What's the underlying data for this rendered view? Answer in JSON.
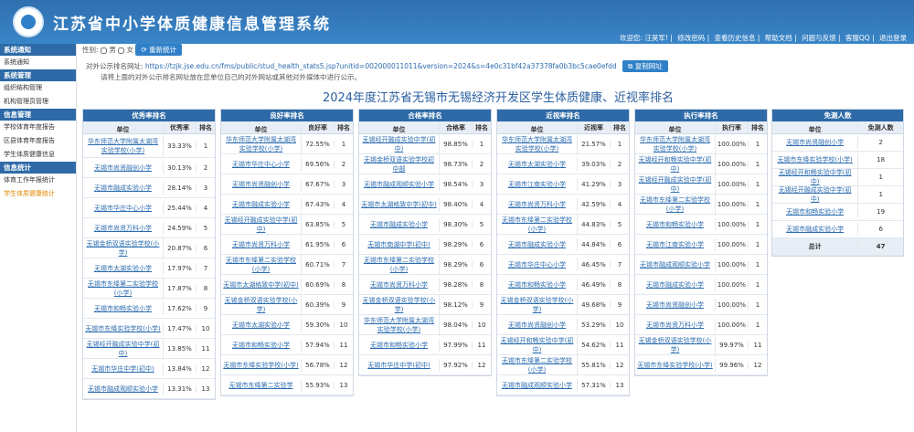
{
  "app": {
    "title": "江苏省中小学体质健康信息管理系统",
    "topbar": [
      "欢迎您: 汪昊军!",
      "修改密码",
      "查看历史信息",
      "帮助文档",
      "问题与反馈",
      "客服QQ",
      "退出登录"
    ]
  },
  "sidebar": [
    {
      "head": "系统通知",
      "items": [
        "系统通知"
      ]
    },
    {
      "head": "系统管理",
      "items": [
        "组织结构管理",
        "机构管理员管理"
      ]
    },
    {
      "head": "信息管理",
      "items": [
        "学校体育年度报告",
        "区县体育年度报告",
        "学生体质健康信息"
      ]
    },
    {
      "head": "信息统计",
      "items": [
        "体育工作年报统计",
        "学生体质健康统计"
      ]
    }
  ],
  "filters": {
    "gender_label": "性别:",
    "male": "男",
    "female": "女",
    "recount": "重新统计"
  },
  "share": {
    "label": "对外公示排名网址:",
    "url": "https://tzjk.jse.edu.cn/fms/public/stud_health_stats5.jsp?unitid=002000011011&version=2024&s=4e0c31bf42a37378fa0b3bc5cae0efdd",
    "copy_button": "复制网址",
    "note": "请将上面的对外公示排名网址放在您单位自己的对外网站或其他对外媒体中进行公示。"
  },
  "page_title": "2024年度江苏省无锡市无锡经济开发区学生体质健康、近视率排名",
  "tables": [
    {
      "title": "优秀率排名",
      "col_unit": "单位",
      "col_rate": "优秀率",
      "col_rank": "排名",
      "rows": [
        {
          "unit": "华东师范大学附属太湖湾实验学校(小学)",
          "rate": "33.33%",
          "rank": "1"
        },
        {
          "unit": "无锡市尚贤融创小学",
          "rate": "30.13%",
          "rank": "2"
        },
        {
          "unit": "无锡市融成实验小学",
          "rate": "28.14%",
          "rank": "3"
        },
        {
          "unit": "无锡市华庄中心小学",
          "rate": "25.44%",
          "rank": "4"
        },
        {
          "unit": "无锡市尚贤万科小学",
          "rate": "24.59%",
          "rank": "5"
        },
        {
          "unit": "无锡金桥双语实验学校(小学)",
          "rate": "20.87%",
          "rank": "6"
        },
        {
          "unit": "无锡市太湖实验小学",
          "rate": "17.97%",
          "rank": "7"
        },
        {
          "unit": "无锡市东绛第二实验学校(小学)",
          "rate": "17.87%",
          "rank": "8"
        },
        {
          "unit": "无锡市和畅实验小学",
          "rate": "17.62%",
          "rank": "9"
        },
        {
          "unit": "无锡市东绛实验学校(小学)",
          "rate": "17.47%",
          "rank": "10"
        },
        {
          "unit": "无锡经开融成实验中学(初中)",
          "rate": "13.85%",
          "rank": "11"
        },
        {
          "unit": "无锡市华庄中学(初中)",
          "rate": "13.84%",
          "rank": "12"
        },
        {
          "unit": "无锡市融成观顺实验小学",
          "rate": "13.31%",
          "rank": "13"
        }
      ]
    },
    {
      "title": "良好率排名",
      "col_unit": "单位",
      "col_rate": "良好率",
      "col_rank": "排名",
      "rows": [
        {
          "unit": "华东师范大学附属太湖湾实验学校(小学)",
          "rate": "72.55%",
          "rank": "1"
        },
        {
          "unit": "无锡市华庄中心小学",
          "rate": "69.56%",
          "rank": "2"
        },
        {
          "unit": "无锡市尚贤融创小学",
          "rate": "67.67%",
          "rank": "3"
        },
        {
          "unit": "无锡市融成实验小学",
          "rate": "67.43%",
          "rank": "4"
        },
        {
          "unit": "无锡经开融成实验中学(初中)",
          "rate": "63.85%",
          "rank": "5"
        },
        {
          "unit": "无锡市尚贤万科小学",
          "rate": "61.95%",
          "rank": "6"
        },
        {
          "unit": "无锡市东绛第二实验学校(小学)",
          "rate": "60.71%",
          "rank": "7"
        },
        {
          "unit": "无锡市太湖格致中学(初中)",
          "rate": "60.69%",
          "rank": "8"
        },
        {
          "unit": "无锡金桥双语实验学校(小学)",
          "rate": "60.39%",
          "rank": "9"
        },
        {
          "unit": "无锡市太湖实验小学",
          "rate": "59.30%",
          "rank": "10"
        },
        {
          "unit": "无锡市和畅实验小学",
          "rate": "57.94%",
          "rank": "11"
        },
        {
          "unit": "无锡市东绛实验学校(小学)",
          "rate": "56.78%",
          "rank": "12"
        },
        {
          "unit": "无锡市东绛第二实验学",
          "rate": "55.93%",
          "rank": "13"
        }
      ]
    },
    {
      "title": "合格率排名",
      "col_unit": "单位",
      "col_rate": "合格率",
      "col_rank": "排名",
      "rows": [
        {
          "unit": "无锡经开融成实验中学(初中)",
          "rate": "98.85%",
          "rank": "1"
        },
        {
          "unit": "无锡金桥双语实验学校初中部",
          "rate": "98.73%",
          "rank": "2"
        },
        {
          "unit": "无锡市融成观顺实验小学",
          "rate": "98.54%",
          "rank": "3"
        },
        {
          "unit": "无锡市太湖格致中学(初中)",
          "rate": "98.40%",
          "rank": "4"
        },
        {
          "unit": "无锡市融成实验小学",
          "rate": "98.30%",
          "rank": "5"
        },
        {
          "unit": "无锡市南湖中学(初中)",
          "rate": "98.29%",
          "rank": "6"
        },
        {
          "unit": "无锡市东绛第二实验学校(小学)",
          "rate": "98.29%",
          "rank": "6"
        },
        {
          "unit": "无锡市尚贤万科小学",
          "rate": "98.28%",
          "rank": "8"
        },
        {
          "unit": "无锡金桥双语实验学校(小学)",
          "rate": "98.12%",
          "rank": "9"
        },
        {
          "unit": "华东师范大学附属太湖湾实验学校(小学)",
          "rate": "98.04%",
          "rank": "10"
        },
        {
          "unit": "无锡市和畅实验小学",
          "rate": "97.99%",
          "rank": "11"
        },
        {
          "unit": "无锡市华庄中学(初中)",
          "rate": "97.92%",
          "rank": "12"
        }
      ]
    },
    {
      "title": "近视率排名",
      "col_unit": "单位",
      "col_rate": "近视率",
      "col_rank": "排名",
      "rows": [
        {
          "unit": "华东师范大学附属太湖湾实验学校(小学)",
          "rate": "21.57%",
          "rank": "1"
        },
        {
          "unit": "无锡市太湖实验小学",
          "rate": "39.03%",
          "rank": "2"
        },
        {
          "unit": "无锡市江南实验小学",
          "rate": "41.29%",
          "rank": "3"
        },
        {
          "unit": "无锡市尚贤万科小学",
          "rate": "42.59%",
          "rank": "4"
        },
        {
          "unit": "无锡市东绛第二实验学校(小学)",
          "rate": "44.83%",
          "rank": "5"
        },
        {
          "unit": "无锡市融成实验小学",
          "rate": "44.84%",
          "rank": "6"
        },
        {
          "unit": "无锡市华庄中心小学",
          "rate": "46.45%",
          "rank": "7"
        },
        {
          "unit": "无锡市和畅实验小学",
          "rate": "46.49%",
          "rank": "8"
        },
        {
          "unit": "无锡金桥双语实验学校(小学)",
          "rate": "49.68%",
          "rank": "9"
        },
        {
          "unit": "无锡市尚贤融创小学",
          "rate": "53.29%",
          "rank": "10"
        },
        {
          "unit": "无锡经开和畅实验中学(初中)",
          "rate": "54.62%",
          "rank": "11"
        },
        {
          "unit": "无锡市东绛第二实验学校(小学)",
          "rate": "55.81%",
          "rank": "12"
        },
        {
          "unit": "无锡市融成观顺实验小学",
          "rate": "57.31%",
          "rank": "13"
        }
      ]
    },
    {
      "title": "执行率排名",
      "col_unit": "单位",
      "col_rate": "执行率",
      "col_rank": "排名",
      "rows": [
        {
          "unit": "华东师范大学附属太湖湾实验学校(小学)",
          "rate": "100.00%",
          "rank": "1"
        },
        {
          "unit": "无锡经开和畅实验中学(初中)",
          "rate": "100.00%",
          "rank": "1"
        },
        {
          "unit": "无锡经开融成实验中学(初中)",
          "rate": "100.00%",
          "rank": "1"
        },
        {
          "unit": "无锡市东绛第二实验学校(小学)",
          "rate": "100.00%",
          "rank": "1"
        },
        {
          "unit": "无锡市和畅实验小学",
          "rate": "100.00%",
          "rank": "1"
        },
        {
          "unit": "无锡市江南实验小学",
          "rate": "100.00%",
          "rank": "1"
        },
        {
          "unit": "无锡市融成观顺实验小学",
          "rate": "100.00%",
          "rank": "1"
        },
        {
          "unit": "无锡市融成实验小学",
          "rate": "100.00%",
          "rank": "1"
        },
        {
          "unit": "无锡市尚贤融创小学",
          "rate": "100.00%",
          "rank": "1"
        },
        {
          "unit": "无锡市尚贤万科小学",
          "rate": "100.00%",
          "rank": "1"
        },
        {
          "unit": "无锡金桥双语实验学校(小学)",
          "rate": "99.97%",
          "rank": "11"
        },
        {
          "unit": "无锡市东绛实验学校(小学)",
          "rate": "99.96%",
          "rank": "12"
        }
      ]
    }
  ],
  "exempt": {
    "title": "免测人数",
    "col_unit": "单位",
    "col_count": "免测人数",
    "rows": [
      {
        "unit": "无锡市尚贤融创小学",
        "count": "2"
      },
      {
        "unit": "无锡市东绛实验学校(小学)",
        "count": "18"
      },
      {
        "unit": "无锡经开和畅实验中学(初中)",
        "count": "1"
      },
      {
        "unit": "无锡经开融成实验中学(初中)",
        "count": "1"
      },
      {
        "unit": "无锡市和畅实验小学",
        "count": "19"
      },
      {
        "unit": "无锡市融成实验小学",
        "count": "6"
      }
    ],
    "total_label": "总计",
    "total": "47"
  }
}
